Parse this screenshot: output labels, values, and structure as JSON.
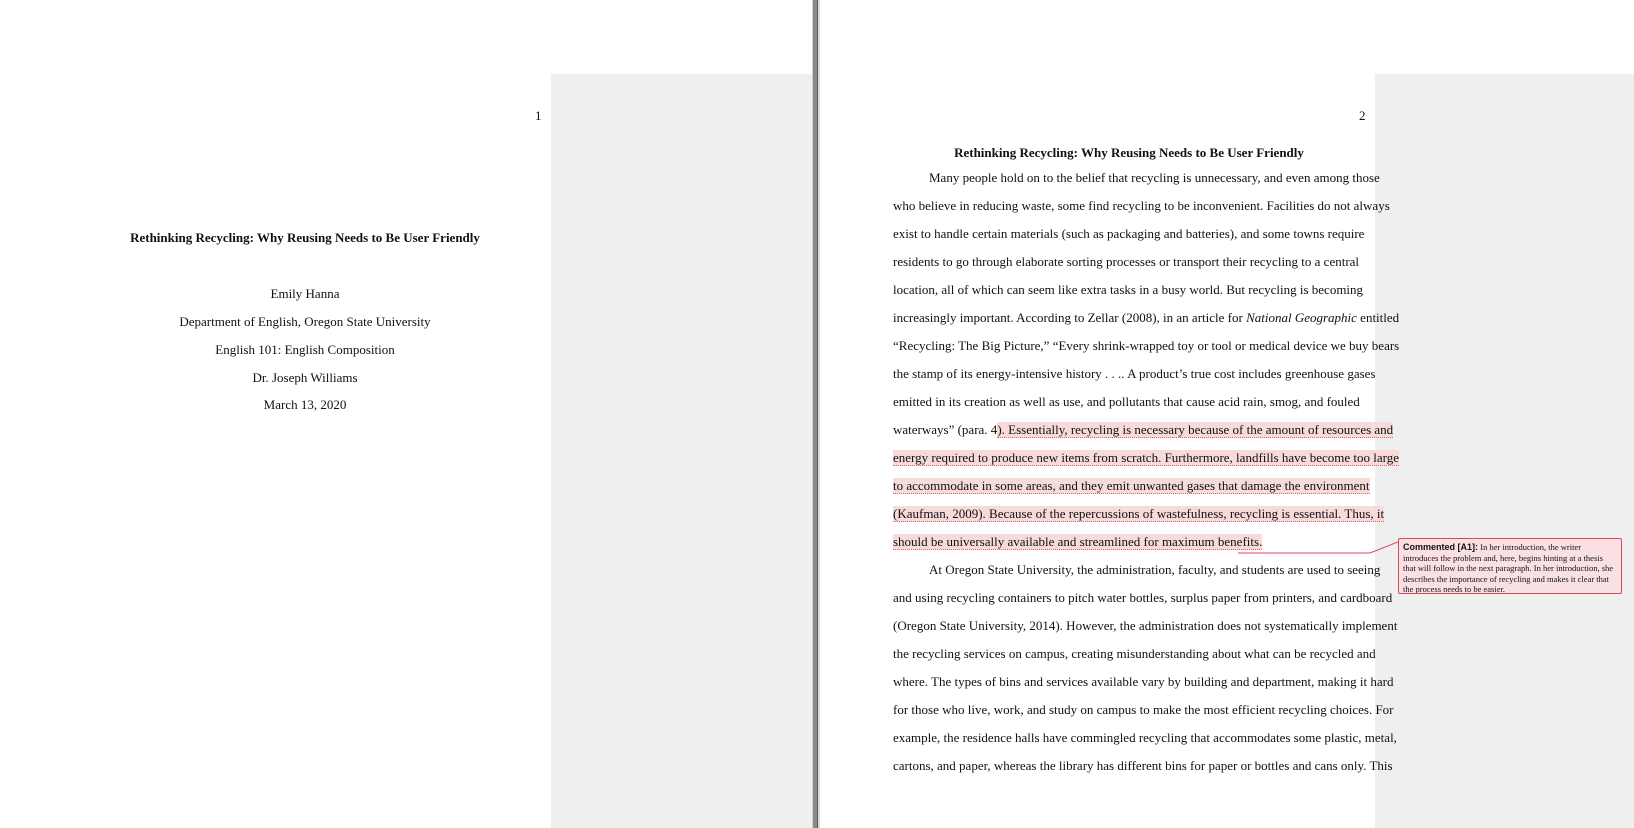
{
  "page1": {
    "page_number": "1",
    "title": "Rethinking Recycling: Why Reusing Needs to Be User Friendly",
    "author": "Emily Hanna",
    "department": "Department of English, Oregon State University",
    "course": "English 101: English Composition",
    "instructor": "Dr. Joseph Williams",
    "date": "March 13, 2020"
  },
  "page2": {
    "page_number": "2",
    "title": "Rethinking Recycling: Why Reusing Needs to Be User Friendly",
    "lines": [
      "Many people hold on to the belief that recycling is unnecessary, and even among those",
      "who believe in reducing waste, some find recycling to be inconvenient. Facilities do not always",
      "exist to handle certain materials (such as packaging and batteries), and some towns require",
      "residents to go through elaborate sorting processes or transport their recycling to a central",
      "location, all of which can seem like extra tasks in a busy world. But recycling is becoming",
      "increasingly important. According to Zellar (2008), in an article for ",
      "“Recycling: The Big Picture,” “Every shrink-wrapped toy or tool or medical device we buy bears",
      "the stamp of its energy-intensive history . . .. A product’s true cost includes greenhouse gases",
      "emitted in its creation as well as use, and pollutants that cause acid rain, smog, and fouled",
      "waterways” (para. 4",
      "energy required to produce new items from scratch. Furthermore, landfills have become too large",
      "to accommodate in some areas, and they emit unwanted gases that damage the environment",
      "(Kaufman, 2009). Because of the repercussions of wastefulness, recycling is essential. Thus, it",
      "should be universally available and streamlined for maximum benefits.",
      "At Oregon State University, the administration, faculty, and students are used to seeing",
      "and using recycling containers to pitch water bottles, surplus paper from printers, and cardboard",
      "(Oregon State University, 2014). However, the administration does not systematically implement",
      "the recycling services on campus, creating misunderstanding about what can be recycled and",
      "where. The types of bins and services available vary by building and department, making it hard",
      "for those who live, work, and study on campus to make the most efficient recycling choices. For",
      "example, the residence halls have commingled recycling that accommodates some plastic, metal,",
      "cartons, and paper, whereas the library has different bins for paper or bottles and cans only. This"
    ],
    "line6_italic": "National Geographic",
    "line6_tail": " entitled",
    "line10_highlight": "). Essentially, recycling is necessary because of the amount of resources and"
  },
  "comment": {
    "label": "Commented [A1]:",
    "text": "In her introduction, the writer introduces the problem and, here, begins hinting at a thesis that will follow in the next paragraph. In her introduction, she describes the importance of recycling and makes it clear that the process needs to be easier.",
    "fill_color": "#fbe0e3",
    "border_color": "#d9485b",
    "highlight_color": "#f7dada"
  }
}
